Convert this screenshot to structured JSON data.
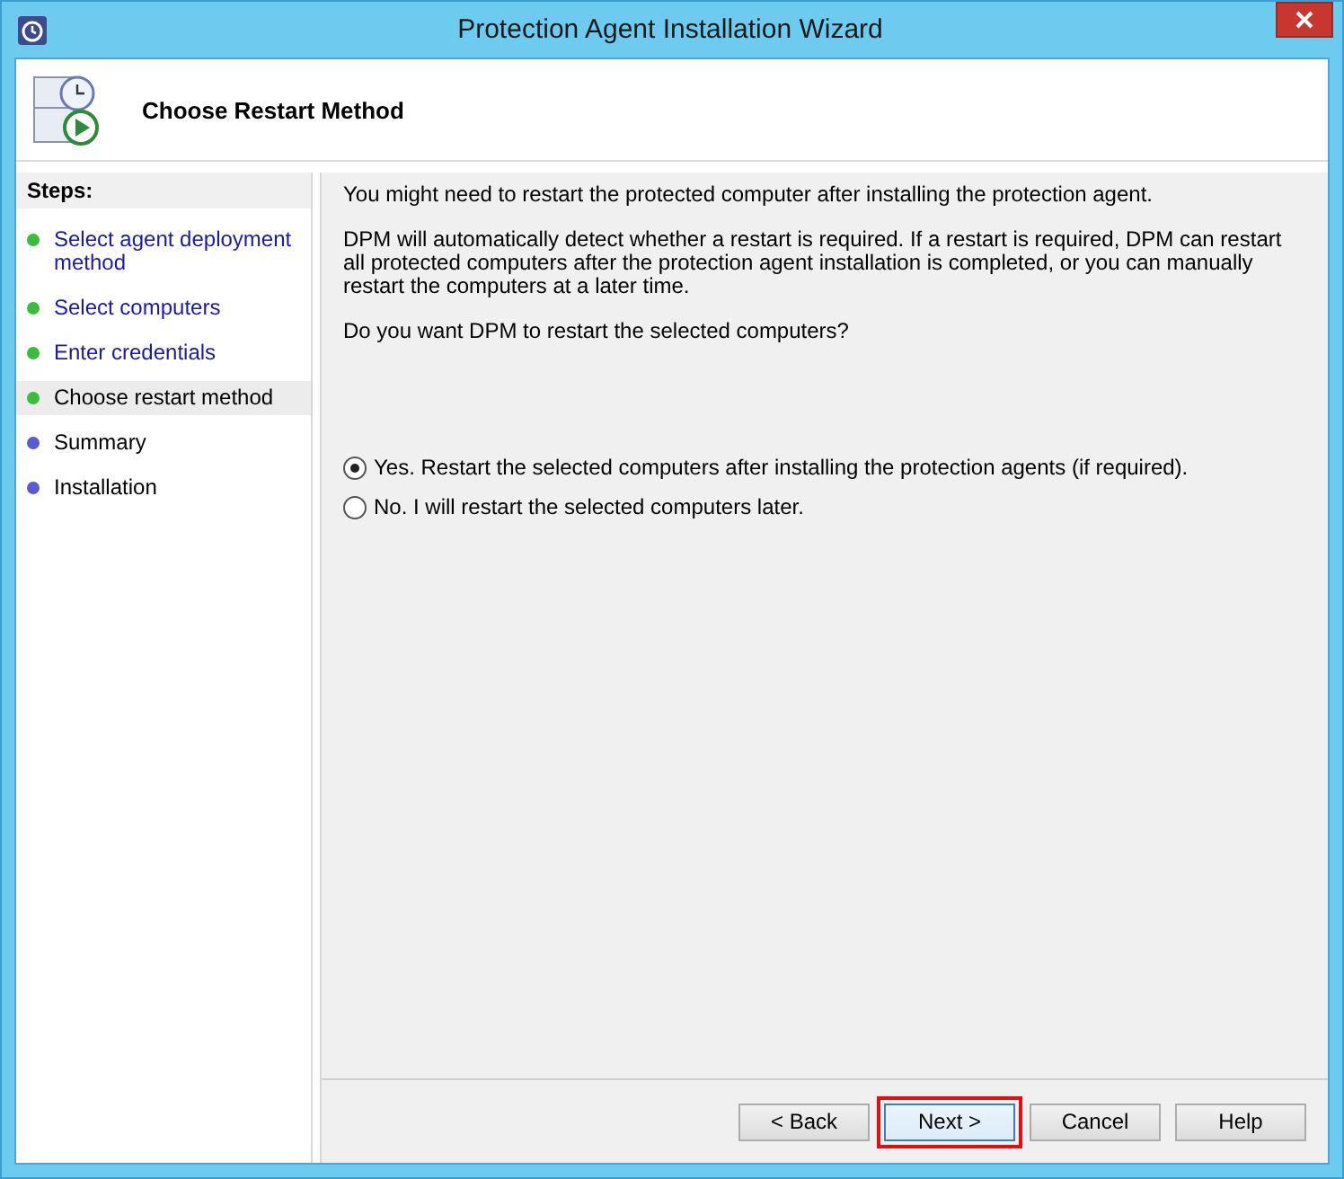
{
  "window": {
    "title": "Protection Agent Installation Wizard"
  },
  "header": {
    "title": "Choose Restart Method"
  },
  "steps": {
    "heading": "Steps:",
    "items": [
      {
        "label": "Select agent deployment method",
        "kind": "link",
        "selected": false,
        "color": "#3dbb3d"
      },
      {
        "label": "Select computers",
        "kind": "link",
        "selected": false,
        "color": "#3dbb3d"
      },
      {
        "label": "Enter credentials",
        "kind": "link",
        "selected": false,
        "color": "#3dbb3d"
      },
      {
        "label": "Choose restart method",
        "kind": "text",
        "selected": true,
        "color": "#3dbb3d"
      },
      {
        "label": "Summary",
        "kind": "text",
        "selected": false,
        "color": "#5b5bd0"
      },
      {
        "label": "Installation",
        "kind": "text",
        "selected": false,
        "color": "#5b5bd0"
      }
    ]
  },
  "content": {
    "paragraphs": [
      "You might need to restart the protected computer after installing the protection agent.",
      "DPM will automatically detect whether a restart is required. If a restart is required, DPM can restart all protected computers after the protection agent installation is completed, or you can manually restart the computers at a later time.",
      "Do you want DPM to restart the selected computers?"
    ],
    "options": [
      {
        "label": "Yes. Restart the selected computers after installing the protection agents (if required).",
        "selected": true
      },
      {
        "label": "No. I will restart the selected computers later.",
        "selected": false
      }
    ]
  },
  "buttons": [
    {
      "label": "< Back",
      "highlighted": false
    },
    {
      "label": "Next >",
      "highlighted": true
    },
    {
      "label": "Cancel",
      "highlighted": false
    },
    {
      "label": "Help",
      "highlighted": false
    }
  ]
}
